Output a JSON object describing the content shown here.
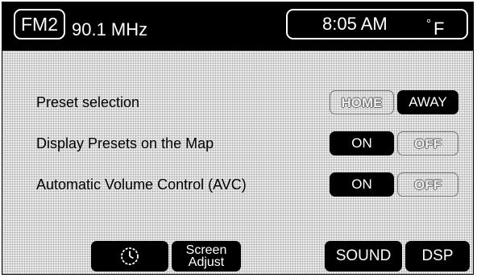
{
  "status_bar": {
    "band": "FM2",
    "frequency": "90.1 MHz",
    "time": "8:05 AM",
    "degree_symbol": "°",
    "temp_unit": "F"
  },
  "rows": [
    {
      "label": "Preset selection",
      "left_option": "HOME",
      "right_option": "AWAY",
      "selected": "AWAY"
    },
    {
      "label": "Display Presets on the Map",
      "left_option": "ON",
      "right_option": "OFF",
      "selected": "ON"
    },
    {
      "label": "Automatic Volume Control (AVC)",
      "left_option": "ON",
      "right_option": "OFF",
      "selected": "ON"
    }
  ],
  "bottom_bar": {
    "clock_icon": "clock-icon",
    "screen_adjust_line1": "Screen",
    "screen_adjust_line2": "Adjust",
    "sound": "SOUND",
    "dsp": "DSP"
  },
  "colors": {
    "selected_bg": "#000000",
    "panel_bg": "#ececec",
    "unselected_text": "#ececec"
  }
}
